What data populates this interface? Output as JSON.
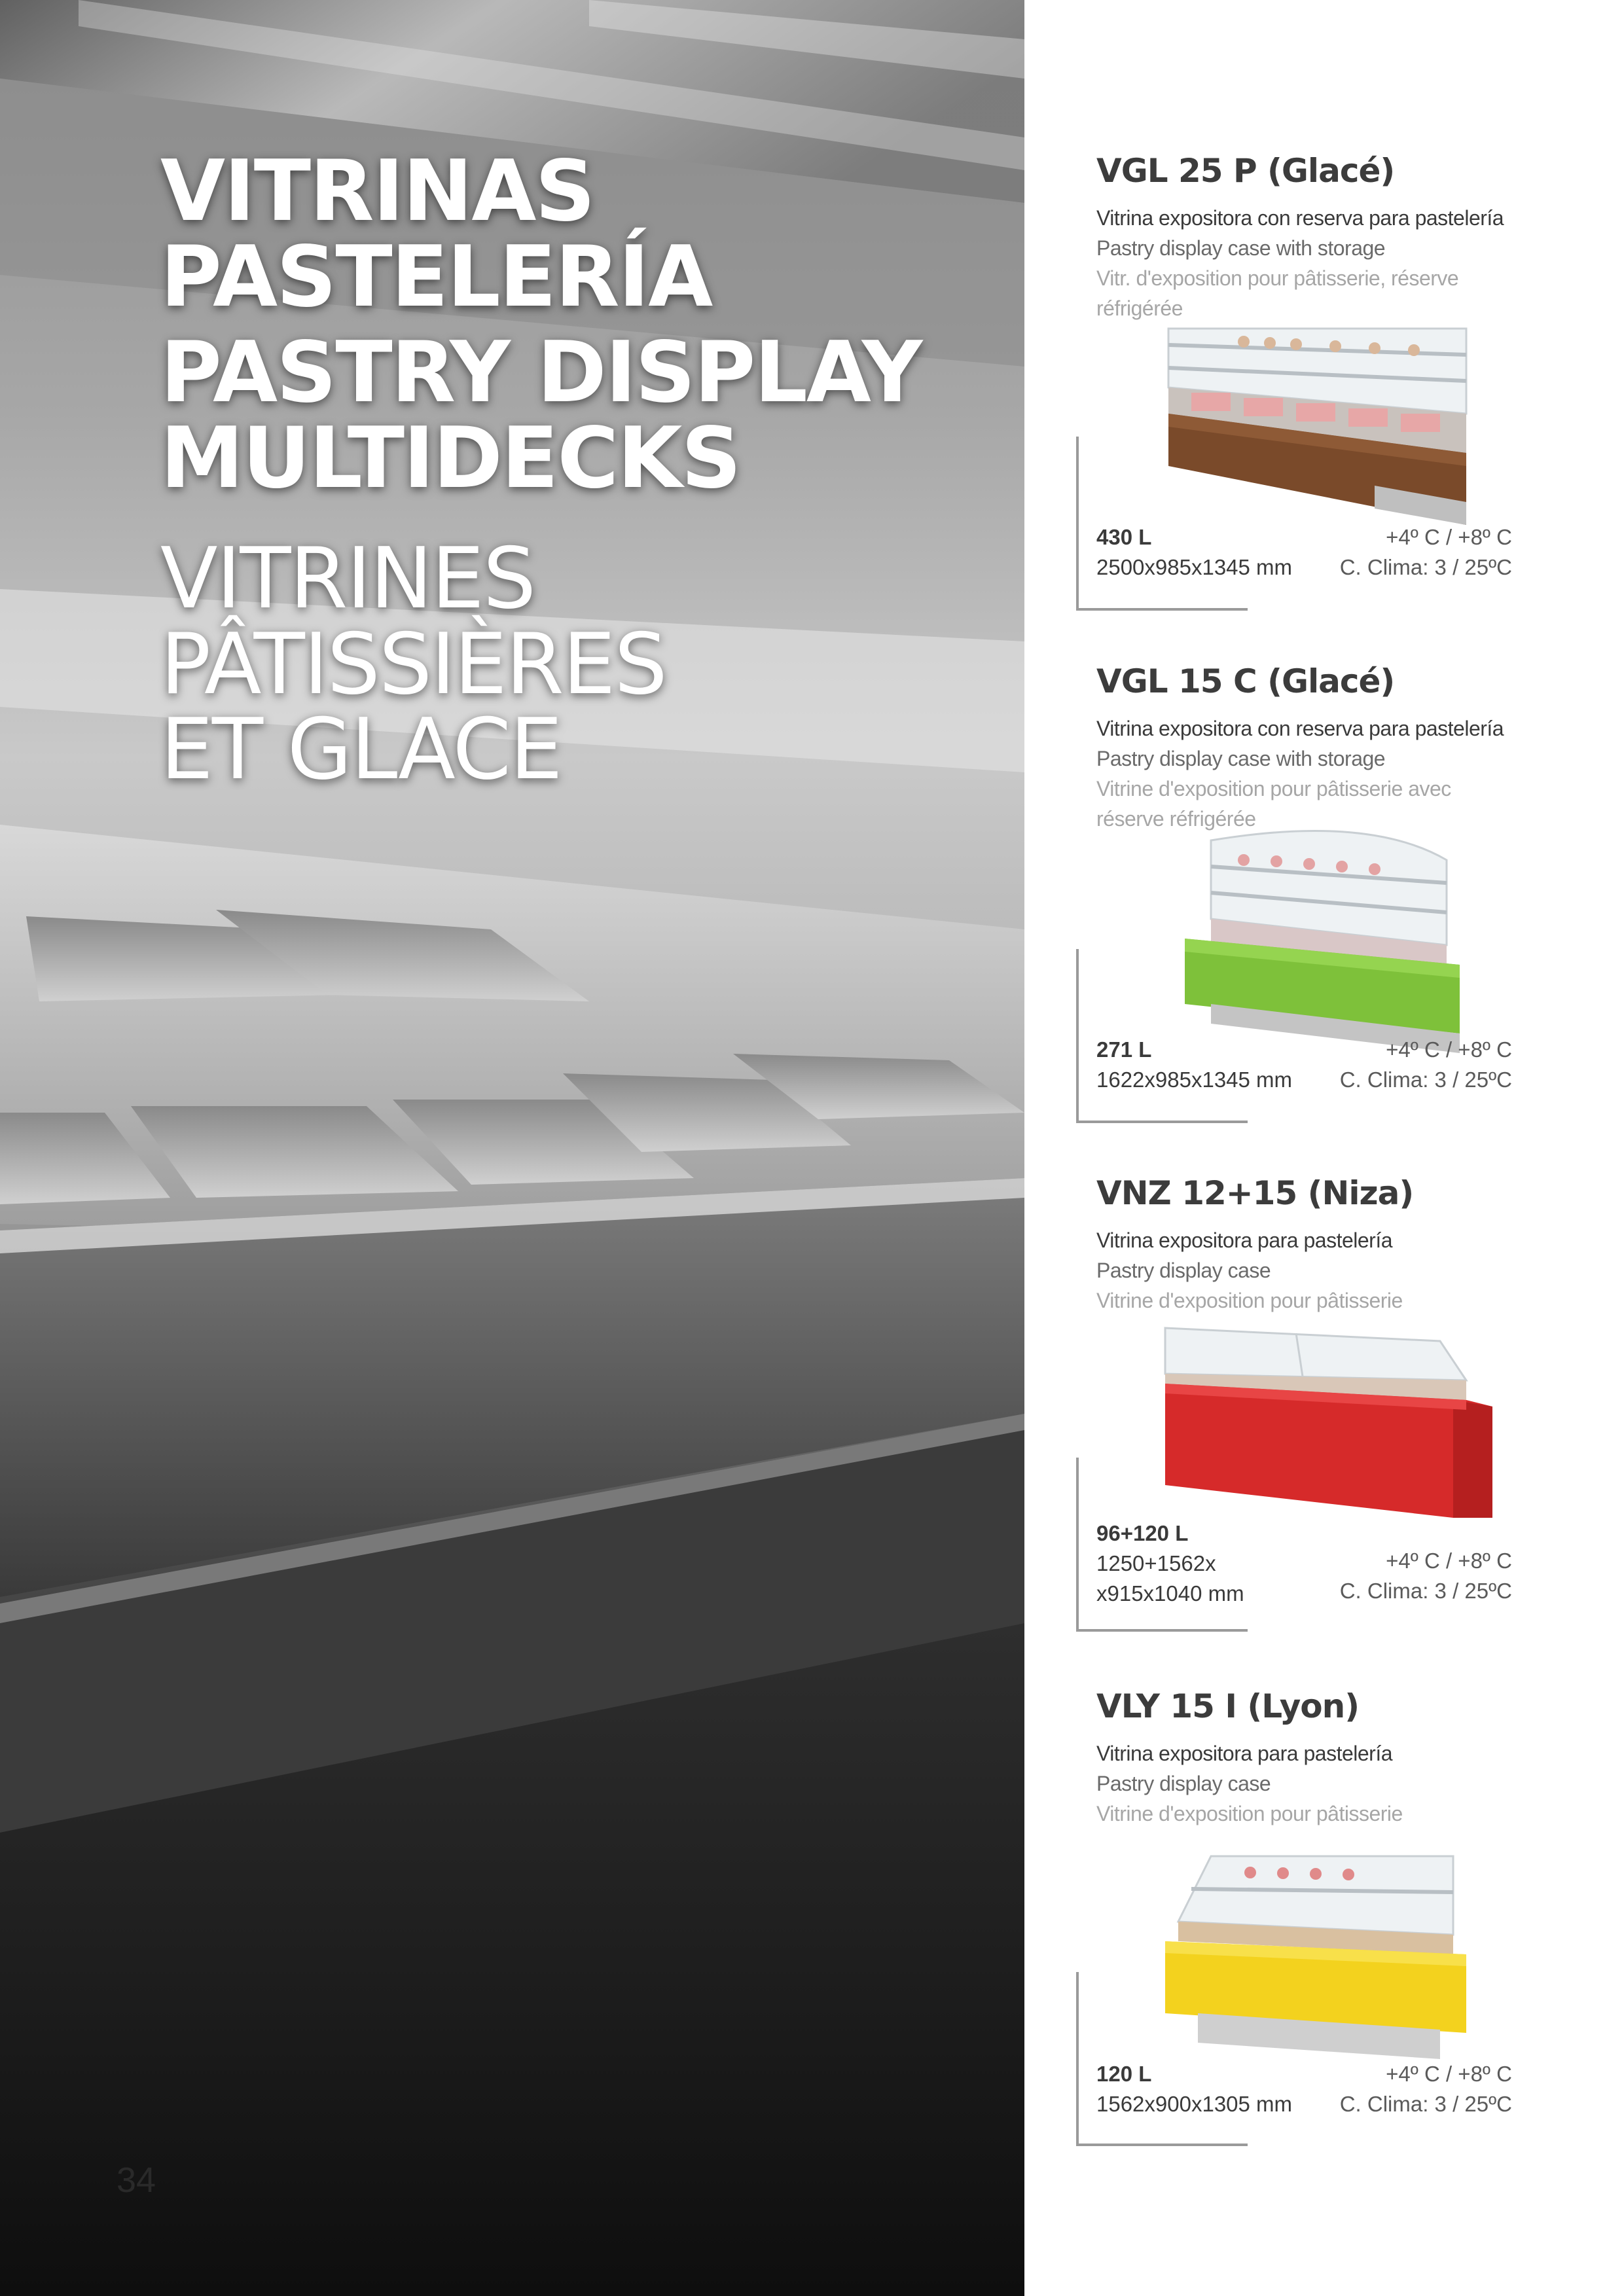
{
  "page": {
    "heading_es": "VITRINAS\nPASTELERÍA",
    "heading_en": "PASTRY DISPLAY\nMULTIDECKS",
    "heading_fr": "VITRINES\nPÂTISSIÈRES\nET GLACE",
    "page_number": "34"
  },
  "colors": {
    "heading_text": "#ffffff",
    "dark_text": "#3a3a3a",
    "mid_text": "#6a6a6a",
    "light_text": "#a6a6a6",
    "bracket": "#9a9a9a"
  },
  "products": [
    {
      "name": "VGL 25 P (Glacé)",
      "desc_es": "Vitrina expositora con reserva para pastelería",
      "desc_en": "Pastry display case with storage",
      "desc_fr": "Vitr. d'exposition pour pâtisserie, réserve réfrigérée",
      "volume": "430 L",
      "dimensions": "2500x985x1345 mm",
      "temperature": "+4º C / +8º C",
      "climate": "C. Clima: 3 / 25ºC",
      "image": "wood-finish-display-case"
    },
    {
      "name": "VGL 15 C (Glacé)",
      "desc_es": "Vitrina expositora con reserva para pastelería",
      "desc_en": "Pastry display case with storage",
      "desc_fr": "Vitrine d'exposition pour pâtisserie avec réserve réfrigérée",
      "volume": "271 L",
      "dimensions": "1622x985x1345 mm",
      "temperature": "+4º C / +8º C",
      "climate": "C. Clima: 3 / 25ºC",
      "image": "green-curved-display-case"
    },
    {
      "name": "VNZ 12+15 (Niza)",
      "desc_es": "Vitrina expositora para pastelería",
      "desc_en": "Pastry display case",
      "desc_fr": "Vitrine d'exposition pour pâtisserie",
      "volume": "96+120 L",
      "dimensions": "1250+1562x\nx915x1040 mm",
      "temperature": "+4º C / +8º C",
      "climate": "C. Clima: 3 / 25ºC",
      "image": "red-display-case"
    },
    {
      "name": "VLY 15 I (Lyon)",
      "desc_es": "Vitrina expositora para pastelería",
      "desc_en": "Pastry display case",
      "desc_fr": "Vitrine d'exposition pour pâtisserie",
      "volume": "120 L",
      "dimensions": "1562x900x1305 mm",
      "temperature": "+4º C / +8º C",
      "climate": "C. Clima: 3 / 25ºC",
      "image": "yellow-display-case"
    }
  ]
}
